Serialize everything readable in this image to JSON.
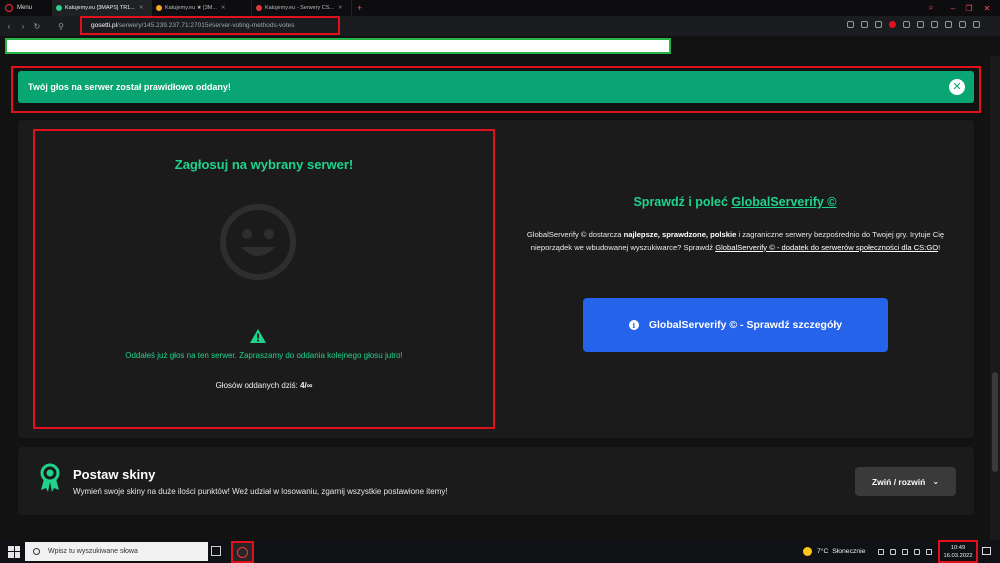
{
  "browser": {
    "menu_label": "Menu",
    "tabs": [
      {
        "title": "Katujemy.eu [3MAPS] TR1..."
      },
      {
        "title": "Katujemy.eu ★ [3M..."
      },
      {
        "title": "Katujemy.eu - Serwery CS..."
      }
    ],
    "new_tab": "+",
    "url_domain": "gosetti.pl",
    "url_path": "/serwery/145.239.237.71:27015#server-voting-methods-votes"
  },
  "alert": {
    "message": "Twój głos na serwer został prawidłowo oddany!",
    "close_symbol": "✕"
  },
  "vote": {
    "title": "Zagłosuj na wybrany serwer!",
    "voted_message": "Oddałeś już głos na ten serwer. Zapraszamy do oddania kolejnego głosu jutro!",
    "votes_today_label": "Głosów oddanych dziś:",
    "votes_today_value": "4/∞"
  },
  "globalserverify": {
    "heading_prefix": "Sprawdź i poleć",
    "heading_link": "GlobalServerify ©",
    "desc_1": "GlobalServerify © dostarcza",
    "desc_bold": "najlepsze, sprawdzone, polskie",
    "desc_2": "i zagraniczne serwery bezpośrednio do Twojej gry. Irytuje Cię nieporządek we wbudowanej wyszukiwarce? Sprawdź",
    "desc_link": "GlobalServerify © - dodatek do serwerów społeczności dla CS:GO",
    "desc_end": "!",
    "button_label": "GlobalServerify © - Sprawdź szczegóły"
  },
  "skins": {
    "title": "Postaw skiny",
    "description": "Wymień swoje skiny na duże ilości punktów! Weź udział w losowaniu, zgarnij wszystkie postawione itemy!",
    "toggle_label": "Zwiń / rozwiń"
  },
  "taskbar": {
    "search_placeholder": "Wpisz tu wyszukiwane słowa",
    "temperature": "7°C",
    "weather": "Słonecznie",
    "time": "10:49",
    "date": "16.03.2022"
  },
  "colors": {
    "accent_green": "#1fd38d",
    "alert_green": "#09a572",
    "button_blue": "#2563eb",
    "highlight_red": "#e0101c"
  }
}
